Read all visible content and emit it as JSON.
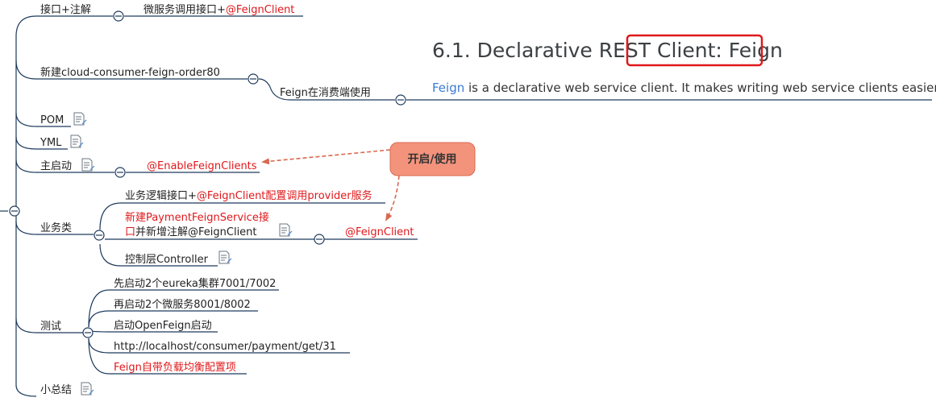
{
  "colors": {
    "line": "#1d3a5c",
    "red_text": "#e0181b",
    "callout_fill": "#f4937c",
    "callout_border": "#d9694f",
    "arrow": "#d9694f",
    "highlight_box": "#e0181b",
    "link": "#3a7bd5"
  },
  "icons": {
    "note": "note-icon",
    "collapse": "collapse-toggle-icon"
  },
  "nodes": {
    "interface_annotation": "接口+注解",
    "microservice_call_prefix": "微服务调用接口+",
    "feign_client_tag": "@FeignClient",
    "new_module": "新建cloud-consumer-feign-order80",
    "consumer_side": "Feign在消费端使用",
    "pom": "POM",
    "yml": "YML",
    "main_boot": "主启动",
    "enable_feign_clients": "@EnableFeignClients",
    "business_class": "业务类",
    "business_interface_prefix": "业务逻辑接口+",
    "business_interface_red": "@FeignClient配置调用provider服务",
    "new_service_line1": "新建PaymentFeignService接",
    "new_service_line2_red": "口",
    "new_service_line2_rest": "并新增注解@FeignClient",
    "feign_client_leaf": "@FeignClient",
    "controller_layer": "控制层Controller",
    "test": "测试",
    "test_step1": "先启动2个eureka集群7001/7002",
    "test_step2": "再启动2个微服务8001/8002",
    "test_step3": "启动OpenFeign启动",
    "test_step4": "http://localhost/consumer/payment/get/31",
    "test_step5": "Feign自带负载均衡配置项",
    "summary": "小总结"
  },
  "callout": {
    "label": "开启/使用"
  },
  "doc_snippet": {
    "heading_prefix": "6.1. Declarative REST ",
    "heading_highlight": "Client: Feign",
    "body_link": "Feign",
    "body_text": " is a declarative web service client. It makes writing web service clients easier. T"
  }
}
